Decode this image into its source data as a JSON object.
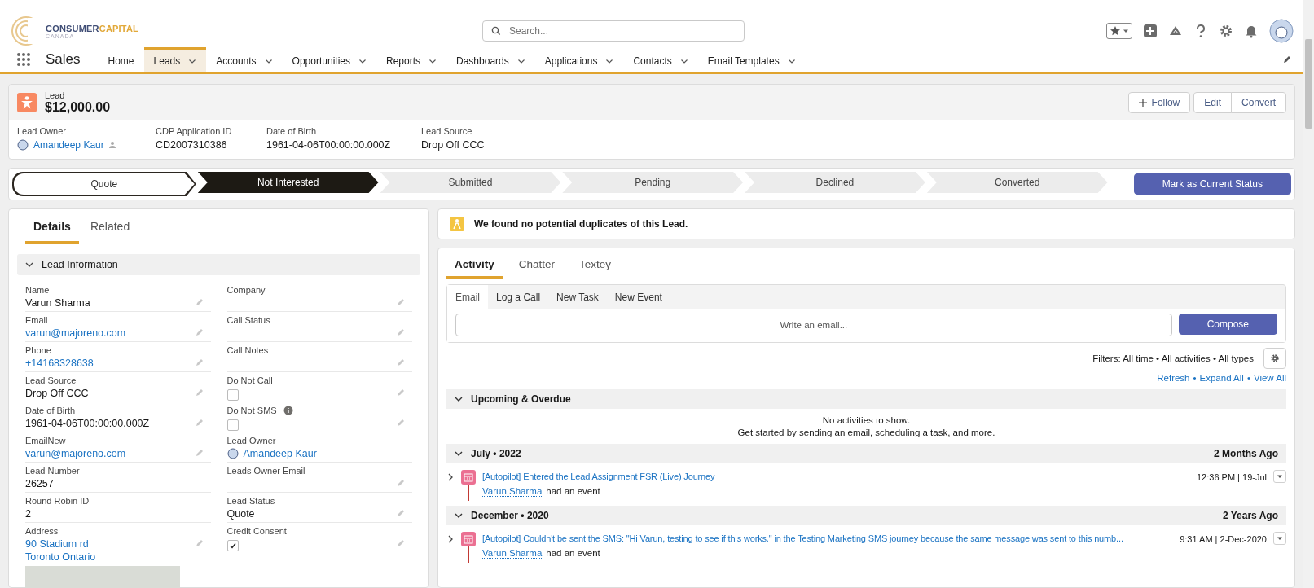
{
  "app": {
    "logo_word_1": "CONSUMER",
    "logo_word_2": "CAPITAL",
    "logo_sub": "CANADA",
    "name": "Sales"
  },
  "search": {
    "placeholder": "Search..."
  },
  "nav": [
    {
      "label": "Home",
      "selected": false,
      "menu": false
    },
    {
      "label": "Leads",
      "selected": true,
      "menu": true
    },
    {
      "label": "Accounts",
      "selected": false,
      "menu": true
    },
    {
      "label": "Opportunities",
      "selected": false,
      "menu": true
    },
    {
      "label": "Reports",
      "selected": false,
      "menu": true
    },
    {
      "label": "Dashboards",
      "selected": false,
      "menu": true
    },
    {
      "label": "Applications",
      "selected": false,
      "menu": true
    },
    {
      "label": "Contacts",
      "selected": false,
      "menu": true
    },
    {
      "label": "Email Templates",
      "selected": false,
      "menu": true
    }
  ],
  "record": {
    "type": "Lead",
    "title": "$12,000.00",
    "follow": "Follow",
    "buttons": [
      "Edit",
      "Convert"
    ],
    "fields": [
      {
        "label": "Lead Owner",
        "value": "Amandeep Kaur",
        "kind": "user"
      },
      {
        "label": "CDP Application ID",
        "value": "CD2007310386",
        "kind": "text"
      },
      {
        "label": "Date of Birth",
        "value": "1961-04-06T00:00:00.000Z",
        "kind": "text"
      },
      {
        "label": "Lead Source",
        "value": "Drop Off CCC",
        "kind": "text"
      }
    ]
  },
  "path": {
    "stages": [
      {
        "label": "Quote",
        "complete": true,
        "selected": false
      },
      {
        "label": "Not Interested",
        "complete": false,
        "selected": true
      },
      {
        "label": "Submitted",
        "complete": false,
        "selected": false
      },
      {
        "label": "Pending",
        "complete": false,
        "selected": false
      },
      {
        "label": "Declined",
        "complete": false,
        "selected": false
      },
      {
        "label": "Converted",
        "complete": false,
        "selected": false
      }
    ],
    "button": "Mark as Current Status"
  },
  "detail_tabs": [
    {
      "label": "Details",
      "selected": true
    },
    {
      "label": "Related",
      "selected": false
    }
  ],
  "section": {
    "title": "Lead Information",
    "expanded": true
  },
  "fields": [
    {
      "label": "Name",
      "kind": "text",
      "value": "Varun Sharma",
      "editable": true
    },
    {
      "label": "Company",
      "kind": "empty",
      "editable": true
    },
    {
      "label": "Email",
      "kind": "link",
      "value": "varun@majoreno.com",
      "editable": true
    },
    {
      "label": "Call Status",
      "kind": "empty",
      "editable": true
    },
    {
      "label": "Phone",
      "kind": "link",
      "value": "+14168328638",
      "editable": true
    },
    {
      "label": "Call Notes",
      "kind": "empty",
      "editable": true
    },
    {
      "label": "Lead Source",
      "kind": "text",
      "value": "Drop Off CCC",
      "editable": true
    },
    {
      "label": "Do Not Call",
      "kind": "checkbox",
      "checked": false,
      "editable": true
    },
    {
      "label": "Date of Birth",
      "kind": "text",
      "value": "1961-04-06T00:00:00.000Z",
      "editable": true
    },
    {
      "label": "Do Not SMS",
      "kind": "checkbox",
      "checked": false,
      "info": true,
      "editable": true
    },
    {
      "label": "EmailNew",
      "kind": "link",
      "value": "varun@majoreno.com",
      "editable": true
    },
    {
      "label": "Lead Owner",
      "kind": "user",
      "value": "Amandeep Kaur",
      "editable": false
    },
    {
      "label": "Lead Number",
      "kind": "text",
      "value": "26257",
      "editable": false
    },
    {
      "label": "Leads Owner Email",
      "kind": "empty",
      "editable": true
    },
    {
      "label": "Round Robin ID",
      "kind": "text",
      "value": "2",
      "editable": false
    },
    {
      "label": "Lead Status",
      "kind": "text",
      "value": "Quote",
      "editable": true
    },
    {
      "label": "Address",
      "kind": "address",
      "lines": [
        "90 Stadium rd",
        "Toronto Ontario"
      ],
      "editable": true
    },
    {
      "label": "Credit Consent",
      "kind": "checkbox",
      "checked": true,
      "editable": true
    }
  ],
  "duplicates": {
    "message": "We found no potential duplicates of this Lead."
  },
  "activity_tabs": [
    {
      "label": "Activity",
      "selected": true
    },
    {
      "label": "Chatter",
      "selected": false
    },
    {
      "label": "Textey",
      "selected": false
    }
  ],
  "composer_tabs": [
    {
      "label": "Email",
      "selected": true
    },
    {
      "label": "Log a Call",
      "selected": false
    },
    {
      "label": "New Task",
      "selected": false
    },
    {
      "label": "New Event",
      "selected": false
    }
  ],
  "composer": {
    "placeholder": "Write an email...",
    "button": "Compose"
  },
  "filters": "Filters: All time • All activities • All types",
  "actions": [
    "Refresh",
    "Expand All",
    "View All"
  ],
  "action_separator": "•",
  "upcoming": {
    "title": "Upcoming & Overdue",
    "empty_lines": [
      "No activities to show.",
      "Get started by sending an email, scheduling a task, and more."
    ]
  },
  "timeline": [
    {
      "title": "July • 2022",
      "ago": "2 Months Ago",
      "items": [
        {
          "subject": "[Autopilot] Entered the Lead Assignment FSR (Live) Journey",
          "who": "Varun Sharma",
          "what": "had an event",
          "time": "12:36 PM | 19-Jul"
        }
      ]
    },
    {
      "title": "December • 2020",
      "ago": "2 Years Ago",
      "items": [
        {
          "subject": "[Autopilot] Couldn't be sent the SMS: \"Hi Varun, testing to see if this works.\" in the Testing Marketing SMS journey because the same message was sent to this numb...",
          "who": "Varun Sharma",
          "what": "had an event",
          "time": "9:31 AM | 2-Dec-2020"
        }
      ]
    }
  ]
}
